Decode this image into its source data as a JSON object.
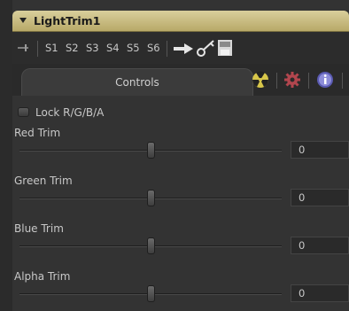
{
  "node": {
    "title": "LightTrim1"
  },
  "toolbar": {
    "slots": [
      {
        "label": "S1",
        "active": true
      },
      {
        "label": "S2",
        "active": false
      },
      {
        "label": "S3",
        "active": false
      },
      {
        "label": "S4",
        "active": false
      },
      {
        "label": "S5",
        "active": true
      },
      {
        "label": "S6",
        "active": false
      }
    ]
  },
  "tabs": {
    "active_label": "Controls",
    "icons": [
      "radioactive-icon",
      "gear-icon",
      "info-icon"
    ]
  },
  "lock": {
    "label": "Lock R/G/B/A",
    "checked": false
  },
  "controls": [
    {
      "label": "Red Trim",
      "value": "0",
      "slider_fraction": 0.5
    },
    {
      "label": "Green Trim",
      "value": "0",
      "slider_fraction": 0.5
    },
    {
      "label": "Blue Trim",
      "value": "0",
      "slider_fraction": 0.5
    },
    {
      "label": "Alpha Trim",
      "value": "0",
      "slider_fraction": 0.5
    }
  ],
  "colors": {
    "header": "#c9bd80",
    "panel": "#333333"
  }
}
